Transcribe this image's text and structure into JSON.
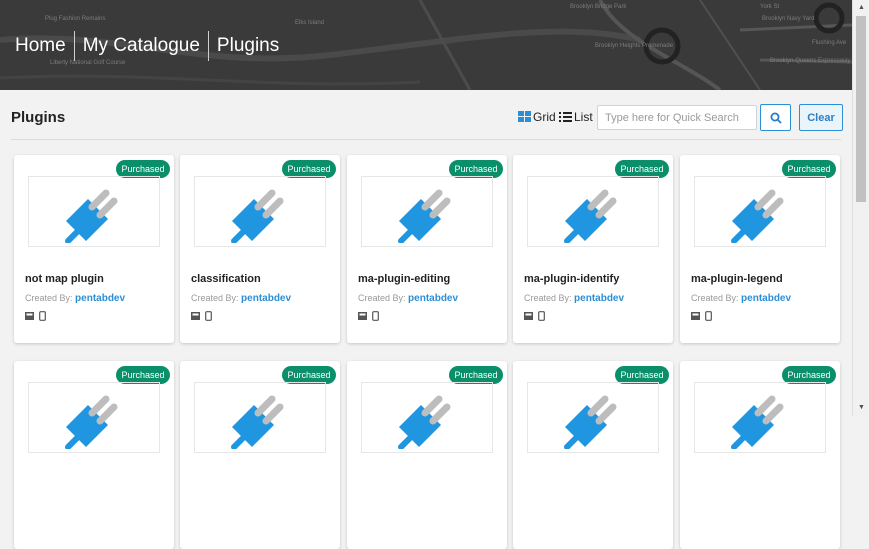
{
  "breadcrumb": [
    "Home",
    "My Catalogue",
    "Plugins"
  ],
  "banner_map_labels": [
    "Elks Island",
    "Brooklyn Bridge Park",
    "Brooklyn Navy Yard",
    "Plug Fashion Remains",
    "Liberty National Golf Course",
    "Brooklyn Heights Promenade",
    "Brooklyn-Queens Expressway",
    "Flushing Ave",
    "York St"
  ],
  "page": {
    "title": "Plugins"
  },
  "view": {
    "grid_label": "Grid",
    "list_label": "List"
  },
  "search": {
    "placeholder": "Type here for Quick Search",
    "clear_label": "Clear"
  },
  "badge_label": "Purchased",
  "created_by_label": "Created By:",
  "cards": [
    {
      "name": "not map plugin",
      "author": "pentabdev"
    },
    {
      "name": "classification",
      "author": "pentabdev"
    },
    {
      "name": "ma-plugin-editing",
      "author": "pentabdev"
    },
    {
      "name": "ma-plugin-identify",
      "author": "pentabdev"
    },
    {
      "name": "ma-plugin-legend",
      "author": "pentabdev"
    }
  ],
  "colors": {
    "accent": "#2c8fd6",
    "badge": "#0b8f6a",
    "plug": "#2196e0"
  }
}
